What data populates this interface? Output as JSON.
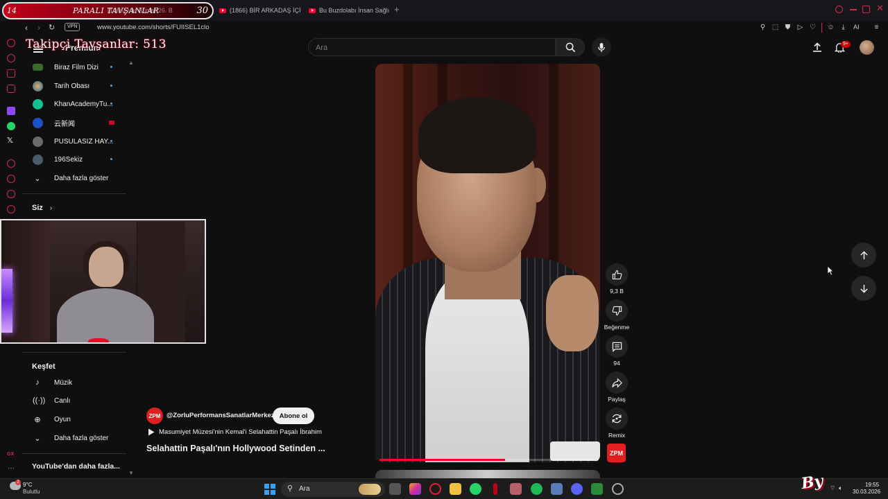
{
  "stream_overlay": {
    "banner_left_number": "14",
    "banner_title": "PARALI TAVŞANLAR",
    "banner_right_number": "30",
    "banner_ghost_text": "(1866) Var Bunlar 26. B",
    "follower_counter": "Takipçi Tavşanlar: 513",
    "bottom_logo": "By"
  },
  "browser": {
    "tabs": [
      {
        "label": "(1866) BİR ARKADAŞ İÇİN"
      },
      {
        "label": "Bu Buzdolabı İnsan Sağlığı"
      }
    ],
    "url": "www.youtube.com/shorts/FUIISEL1clo",
    "vpn_label": "VPN",
    "ai_label": "AI"
  },
  "guide": {
    "premium_label": "Premium",
    "subscriptions": [
      {
        "label": "Biraz Film Dizi",
        "color": "#3a6b2a"
      },
      {
        "label": "Tarih Obası",
        "color": "#2a6a8a"
      },
      {
        "label": "KhanAcademyTu...",
        "color": "#14bf96"
      },
      {
        "label": "云新闻",
        "color": "#1e50c8"
      },
      {
        "label": "PUSULASIZ HAY...",
        "color": "#6a6a6a"
      },
      {
        "label": "196Sekiz",
        "color": "#4a5a6a"
      }
    ],
    "show_more_1": "Daha fazla göster",
    "you_section": "Siz",
    "explore_header": "Keşfet",
    "explore_items": [
      {
        "label": "Müzik",
        "icon": "music-note-icon"
      },
      {
        "label": "Canlı",
        "icon": "live-icon"
      },
      {
        "label": "Oyun",
        "icon": "gamepad-icon"
      }
    ],
    "show_more_2": "Daha fazla göster",
    "more_from_youtube": "YouTube'dan daha fazla..."
  },
  "header": {
    "search_placeholder": "Ara",
    "notification_count": "9+"
  },
  "short": {
    "progress_fraction": 0.58,
    "channel_handle": "@ZorluPerformansSanatlarMerkezi",
    "channel_avatar_text": "ZPM",
    "subscribe_label": "Abone ol",
    "music_text": "Masumiyet Müzesi'nin Kemal'i Selahattin Paşalı İbrahim",
    "title": "Selahattin Paşalı'nın Hollywood Setinden ...",
    "actions": {
      "like_count": "9,3 B",
      "dislike_label": "Beğenme",
      "comment_count": "94",
      "share_label": "Paylaş",
      "remix_label": "Remix"
    }
  },
  "taskbar": {
    "weather_temp": "9°C",
    "weather_desc": "Bulutlu",
    "weather_badge": "2",
    "search_placeholder": "Ara",
    "time": "19:55",
    "date": "30.03.2026"
  },
  "colors": {
    "youtube_red": "#ff0033",
    "opera_accent": "#c9304a",
    "subscribe_bg": "#f1f1f1",
    "page_bg": "#0f0f0f"
  }
}
